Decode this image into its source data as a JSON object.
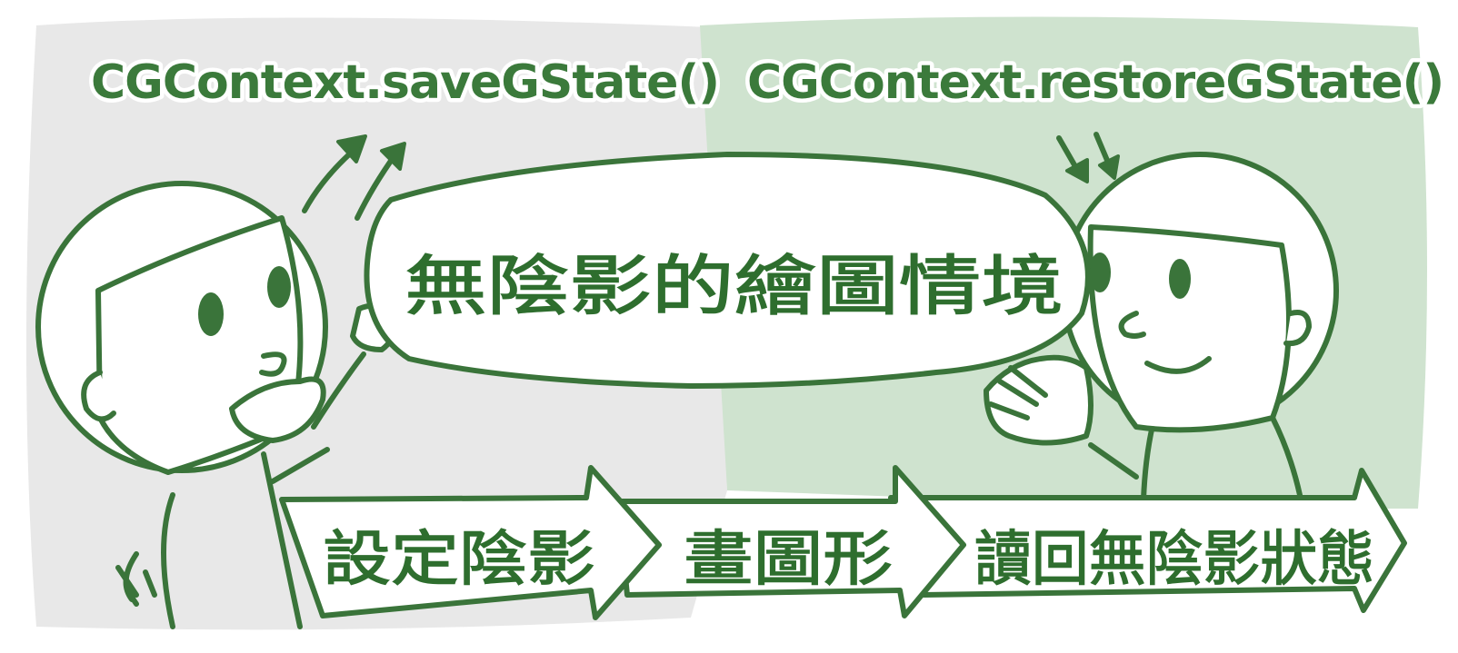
{
  "left_title": "CGContext.saveGState()",
  "right_title": "CGContext.restoreGState()",
  "bubble_text": "無陰影的繪圖情境",
  "steps": [
    "設定陰影",
    "畫圖形",
    "讀回無陰影狀態"
  ],
  "colors": {
    "left_panel": "#e8e8e8",
    "right_panel": "#cfe3cf",
    "ink": "#3a743a",
    "title_text": "#3b7a3b"
  }
}
